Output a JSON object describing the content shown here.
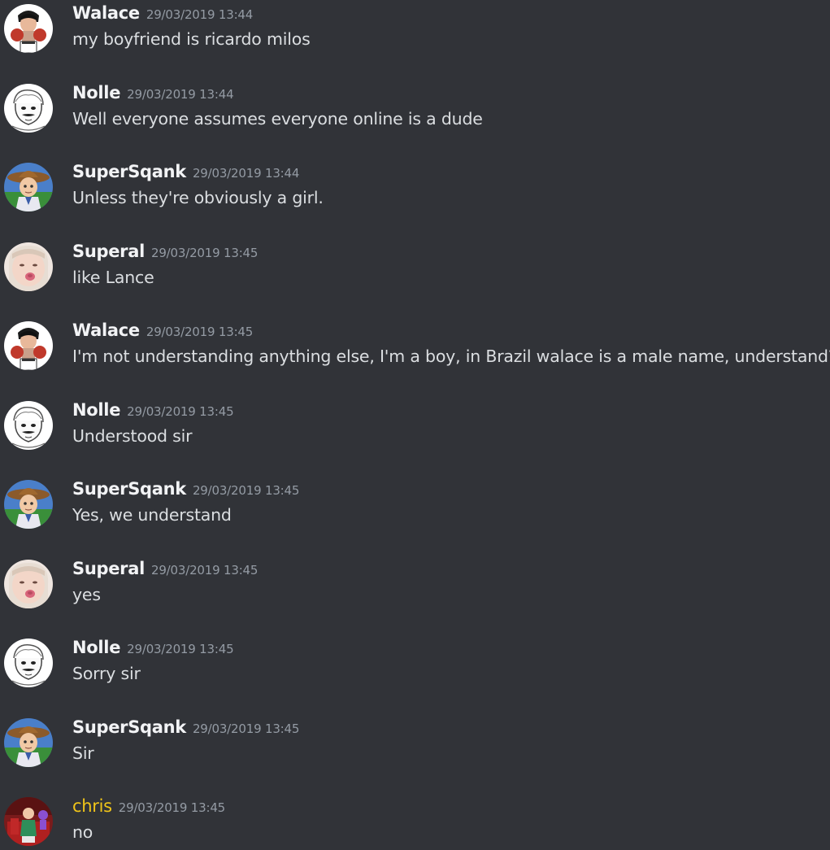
{
  "colors": {
    "background": "#313338",
    "message_text": "#dbdee1",
    "timestamp": "#949ba4",
    "default_username": "#f2f3f5",
    "chris_username": "#f0c419"
  },
  "messages": [
    {
      "author": "Walace",
      "timestamp": "29/03/2019 13:44",
      "text": "my boyfriend is ricardo milos",
      "avatar": "boxer-avatar-icon"
    },
    {
      "author": "Nolle",
      "timestamp": "29/03/2019 13:44",
      "text": "Well everyone assumes everyone online is a dude",
      "avatar": "sketch-face-avatar-icon"
    },
    {
      "author": "SuperSqank",
      "timestamp": "29/03/2019 13:44",
      "text": "Unless they're obviously a girl.",
      "avatar": "cowboy-avatar-icon"
    },
    {
      "author": "Superal",
      "timestamp": "29/03/2019 13:45",
      "text": "like Lance",
      "avatar": "girl-avatar-icon"
    },
    {
      "author": "Walace",
      "timestamp": "29/03/2019 13:45",
      "text": "I'm not understanding anything else, I'm a boy, in Brazil walace is a male name, understand?",
      "avatar": "boxer-avatar-icon"
    },
    {
      "author": "Nolle",
      "timestamp": "29/03/2019 13:45",
      "text": "Understood sir",
      "avatar": "sketch-face-avatar-icon"
    },
    {
      "author": "SuperSqank",
      "timestamp": "29/03/2019 13:45",
      "text": "Yes, we understand",
      "avatar": "cowboy-avatar-icon"
    },
    {
      "author": "Superal",
      "timestamp": "29/03/2019 13:45",
      "text": "yes",
      "avatar": "girl-avatar-icon"
    },
    {
      "author": "Nolle",
      "timestamp": "29/03/2019 13:45",
      "text": "Sorry sir",
      "avatar": "sketch-face-avatar-icon"
    },
    {
      "author": "SuperSqank",
      "timestamp": "29/03/2019 13:45",
      "text": "Sir",
      "avatar": "cowboy-avatar-icon"
    },
    {
      "author": "chris",
      "timestamp": "29/03/2019 13:45",
      "text": "no",
      "avatar": "red-room-avatar-icon"
    }
  ]
}
